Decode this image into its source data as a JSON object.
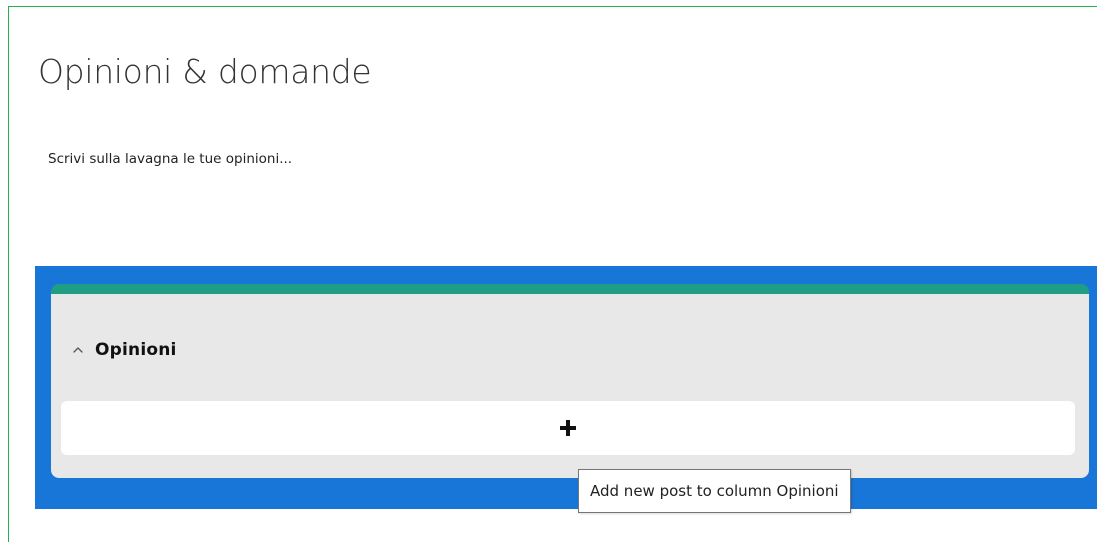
{
  "page": {
    "title": "Opinioni & domande",
    "intro": "Scrivi sulla lavagna le tue opinioni..."
  },
  "board": {
    "background_color": "#1976d9",
    "columns": [
      {
        "title": "Opinioni",
        "header_color": "#1f9e85",
        "collapse_icon": "chevron-up-icon",
        "add_icon": "plus-icon"
      }
    ]
  },
  "tooltip": {
    "text": "Add new post to column Opinioni"
  }
}
